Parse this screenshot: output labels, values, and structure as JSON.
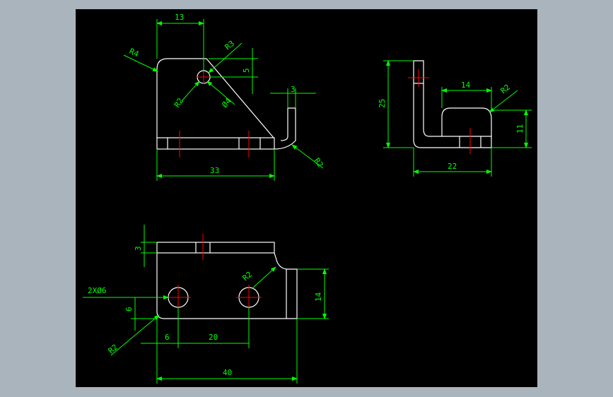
{
  "drawing": {
    "top_view": {
      "dims": {
        "width_13": "13",
        "r4": "R4",
        "r3": "R3",
        "v5": "5",
        "r2_hole": "R2",
        "dia4": "Ø4",
        "t3": "3",
        "r2_bend": "R2",
        "len33": "33"
      }
    },
    "side_view": {
      "dims": {
        "h25": "25",
        "w14": "14",
        "r2": "R2",
        "h11": "11",
        "w22": "22"
      }
    },
    "front_view": {
      "dims": {
        "t3": "3",
        "holes": "2XØ6",
        "r2_notch": "R2",
        "h14": "14",
        "v6": "6",
        "x6": "6",
        "x20": "20",
        "r2_corner": "R2",
        "len40": "40"
      }
    }
  },
  "colors": {
    "background": "#aab4bd",
    "canvas": "#000000",
    "geometry": "#ffffff",
    "dimension": "#00ff00",
    "centerline": "#ff0000"
  }
}
